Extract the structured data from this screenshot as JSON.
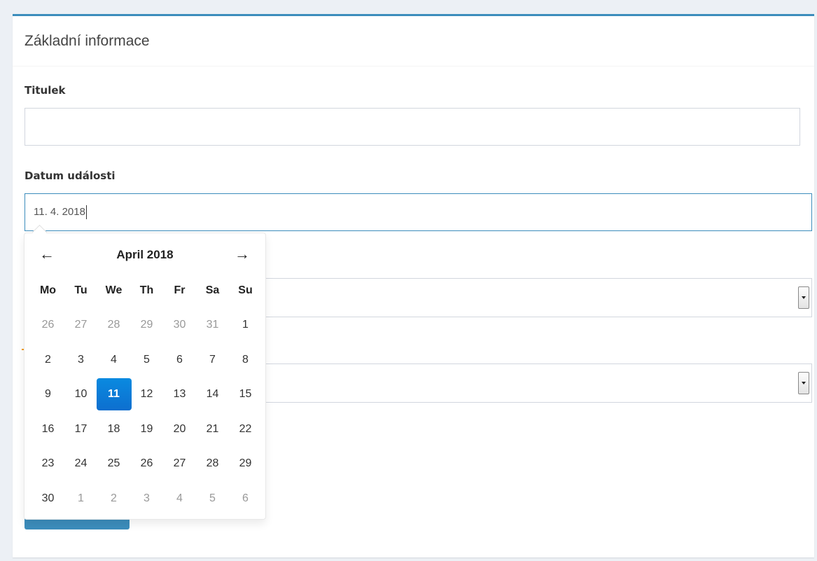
{
  "box": {
    "title": "Základní informace"
  },
  "form": {
    "title_label": "Titulek",
    "title_value": "",
    "date_label": "Datum události",
    "date_value": "11. 4. 2018"
  },
  "datepicker": {
    "prev": "←",
    "next": "→",
    "month_title": "April 2018",
    "weekdays": [
      "Mo",
      "Tu",
      "We",
      "Th",
      "Fr",
      "Sa",
      "Su"
    ],
    "weeks": [
      [
        "26",
        "27",
        "28",
        "29",
        "30",
        "31",
        "1"
      ],
      [
        "2",
        "3",
        "4",
        "5",
        "6",
        "7",
        "8"
      ],
      [
        "9",
        "10",
        "11",
        "12",
        "13",
        "14",
        "15"
      ],
      [
        "16",
        "17",
        "18",
        "19",
        "20",
        "21",
        "22"
      ],
      [
        "23",
        "24",
        "25",
        "26",
        "27",
        "28",
        "29"
      ],
      [
        "30",
        "1",
        "2",
        "3",
        "4",
        "5",
        "6"
      ]
    ],
    "selected_day": "11",
    "accent_color": "#0d6fcf"
  }
}
